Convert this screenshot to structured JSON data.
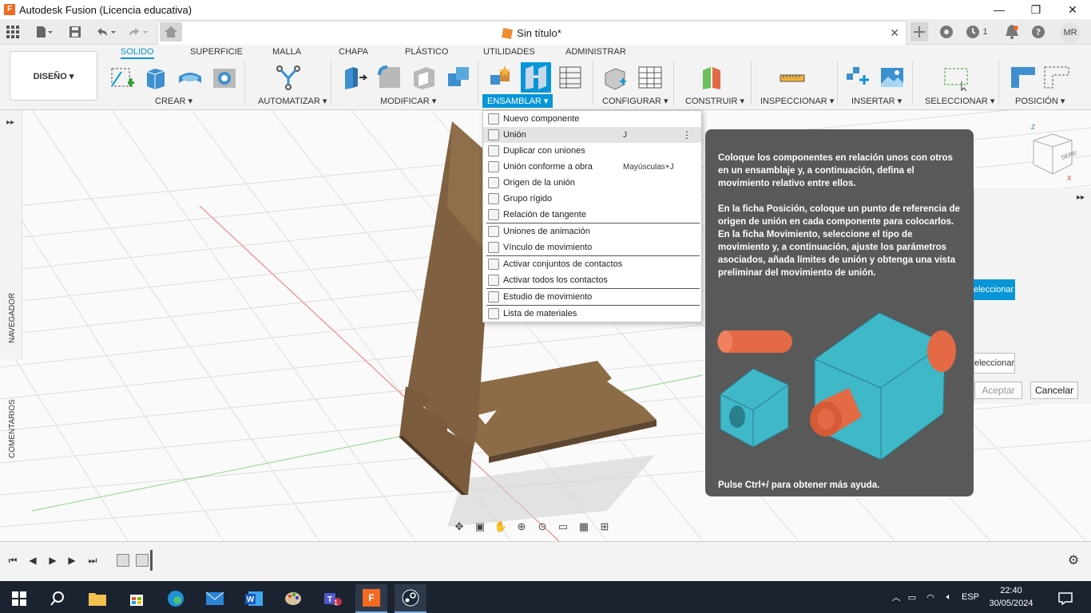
{
  "window": {
    "title": "Autodesk Fusion (Licencia educativa)",
    "logo_letter": "F",
    "minimize": "—",
    "maximize": "❐",
    "close": "✕"
  },
  "document": {
    "tab_title": "Sin título*",
    "tab_close": "✕",
    "jobs_count": "1",
    "user_initials": "MR"
  },
  "workspace": {
    "label": "DISEÑO ▾"
  },
  "ribbon_tabs": [
    "SOLIDO",
    "SUPERFICIE",
    "MALLA",
    "CHAPA",
    "PLÁSTICO",
    "UTILIDADES",
    "ADMINISTRAR"
  ],
  "ribbon_groups": {
    "crear": "CREAR ▾",
    "automatizar": "AUTOMATIZAR ▾",
    "modificar": "MODIFICAR ▾",
    "ensamblar": "ENSAMBLAR ▾",
    "configurar": "CONFIGURAR ▾",
    "construir": "CONSTRUIR ▾",
    "inspeccionar": "INSPECCIONAR ▾",
    "insertar": "INSERTAR ▾",
    "seleccionar": "SELECCIONAR ▾",
    "posicion": "POSICIÓN ▾"
  },
  "side_panel": {
    "navegador": "NAVEGADOR",
    "comentarios": "COMENTARIOS",
    "expand": "▸▸"
  },
  "menu": {
    "items": [
      {
        "label": "Nuevo componente",
        "shortcut": ""
      },
      {
        "label": "Unión",
        "shortcut": "J"
      },
      {
        "label": "Duplicar con uniones",
        "shortcut": ""
      },
      {
        "label": "Unión conforme a obra",
        "shortcut": "Mayúsculas+J"
      },
      {
        "label": "Origen de la unión",
        "shortcut": ""
      },
      {
        "label": "Grupo rígido",
        "shortcut": ""
      },
      {
        "label": "Relación de tangente",
        "shortcut": ""
      },
      {
        "label": "Uniones de animación",
        "shortcut": ""
      },
      {
        "label": "Vínculo de movimiento",
        "shortcut": ""
      },
      {
        "label": "Activar conjuntos de contactos",
        "shortcut": ""
      },
      {
        "label": "Activar todos los contactos",
        "shortcut": ""
      },
      {
        "label": "Estudio de movimiento",
        "shortcut": ""
      },
      {
        "label": "Lista de materiales",
        "shortcut": ""
      }
    ],
    "more": "⋮"
  },
  "tooltip": {
    "p1": "Coloque los componentes en relación unos con otros en un ensamblaje y, a continuación, defina el movimiento relativo entre ellos.",
    "p2": "En la ficha Posición, coloque un punto de referencia de origen de unión en cada componente para colocarlos. En la ficha Movimiento, seleccione el tipo de movimiento y, a continuación, ajuste los parámetros asociados, añada límites de unión y obtenga una vista preliminar del movimiento de unión.",
    "help": "Pulse Ctrl+/ para obtener más ayuda."
  },
  "dialog": {
    "select1": "eleccionar",
    "select2": "eleccionar",
    "accept": "Aceptar",
    "cancel": "Cancelar",
    "expand": "▸▸"
  },
  "viewcube": {
    "face": "DERECHA",
    "z_axis": "Z",
    "x_axis": "X"
  },
  "taskbar": {
    "language": "ESP",
    "time": "22:40",
    "date": "30/05/2024",
    "teams_badge": "1"
  },
  "colors": {
    "accent": "#0696d7",
    "tooltip_bg": "#595959",
    "taskbar_bg": "#1b2330",
    "wood": "#7a5d3e",
    "teal": "#3fb8c8",
    "orange": "#e36a45"
  }
}
